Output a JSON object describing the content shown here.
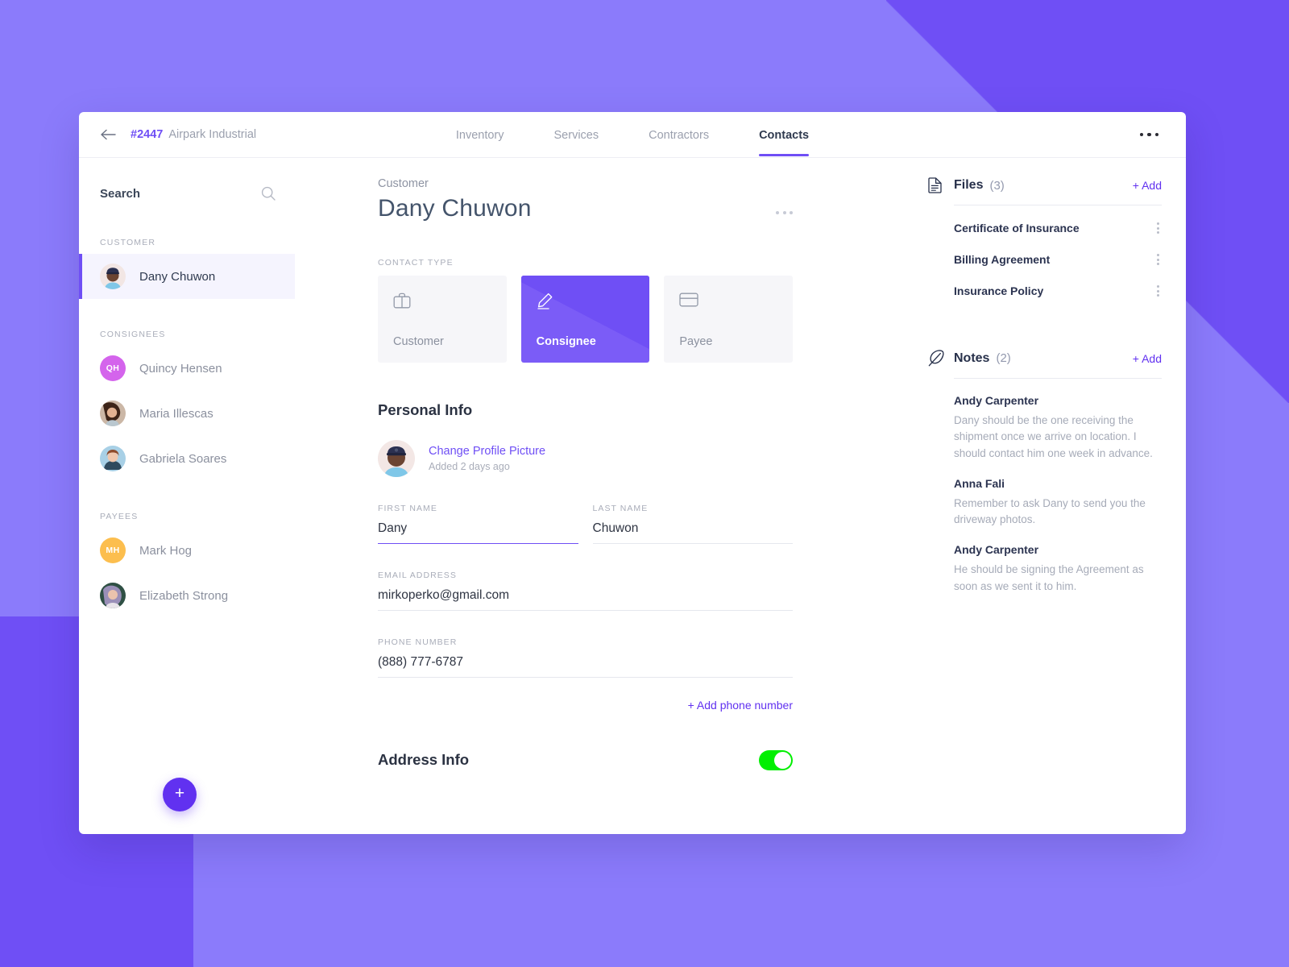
{
  "theme": {
    "bg_purple": "#8b7bfb",
    "bg_purple_dark": "#6f4ff5",
    "accent": "#6131f0",
    "toggle_on": "#00ef00"
  },
  "topbar": {
    "back_icon": "arrow-left-icon",
    "order_id": "#2447",
    "order_name": "Airpark Industrial",
    "overflow_icon": "ellipsis-icon",
    "tabs": [
      {
        "label": "Inventory",
        "active": false
      },
      {
        "label": "Services",
        "active": false
      },
      {
        "label": "Contractors",
        "active": false
      },
      {
        "label": "Contacts",
        "active": true
      }
    ]
  },
  "sidebar": {
    "search_placeholder": "Search",
    "search_value": "",
    "search_icon": "search-icon",
    "add_button_label": "+",
    "groups": [
      {
        "label": "CUSTOMER",
        "items": [
          {
            "name": "Dany Chuwon",
            "avatar": "photo-dany",
            "initials": "",
            "active": true
          }
        ]
      },
      {
        "label": "CONSIGNEES",
        "items": [
          {
            "name": "Quincy Hensen",
            "avatar": "initials",
            "initials": "QH",
            "color": "#d464ec",
            "active": false
          },
          {
            "name": "Maria Illescas",
            "avatar": "photo-maria",
            "initials": "",
            "active": false
          },
          {
            "name": "Gabriela Soares",
            "avatar": "photo-gabriela",
            "initials": "",
            "active": false
          }
        ]
      },
      {
        "label": "PAYEES",
        "items": [
          {
            "name": "Mark Hog",
            "avatar": "initials",
            "initials": "MH",
            "color": "#fcbe4e",
            "active": false
          },
          {
            "name": "Elizabeth Strong",
            "avatar": "photo-elizabeth",
            "initials": "",
            "active": false
          }
        ]
      }
    ]
  },
  "main": {
    "eyebrow": "Customer",
    "title": "Dany Chuwon",
    "overflow_icon": "ellipsis-icon",
    "contact_type_label": "CONTACT TYPE",
    "contact_types": [
      {
        "label": "Customer",
        "icon": "briefcase-icon",
        "selected": false
      },
      {
        "label": "Consignee",
        "icon": "pencil-icon",
        "selected": true
      },
      {
        "label": "Payee",
        "icon": "credit-card-icon",
        "selected": false
      }
    ],
    "personal_info_heading": "Personal Info",
    "change_picture_link": "Change Profile Picture",
    "picture_added": "Added 2 days ago",
    "fields": {
      "first_name_label": "FIRST NAME",
      "first_name_value": "Dany",
      "last_name_label": "LAST NAME",
      "last_name_value": "Chuwon",
      "email_label": "EMAIL ADDRESS",
      "email_value": "mirkoperko@gmail.com",
      "phone_label": "PHONE NUMBER",
      "phone_value": "(888) 777-6787"
    },
    "add_phone_label": "+ Add phone number",
    "address_heading": "Address Info",
    "address_toggle_on": true
  },
  "rightpanel": {
    "files": {
      "icon": "document-icon",
      "title": "Files",
      "count": "(3)",
      "add_label": "+ Add",
      "items": [
        {
          "name": "Certificate of Insurance"
        },
        {
          "name": "Billing Agreement"
        },
        {
          "name": "Insurance Policy"
        }
      ]
    },
    "notes": {
      "icon": "feather-icon",
      "title": "Notes",
      "count": "(2)",
      "add_label": "+ Add",
      "items": [
        {
          "author": "Andy Carpenter",
          "text": "Dany should be the one receiving the shipment once we arrive on location. I should contact him one week in advance."
        },
        {
          "author": "Anna Fali",
          "text": "Remember to ask Dany to send you the driveway photos."
        },
        {
          "author": "Andy Carpenter",
          "text": "He should be signing the Agreement as soon as we sent it to him."
        }
      ]
    }
  }
}
